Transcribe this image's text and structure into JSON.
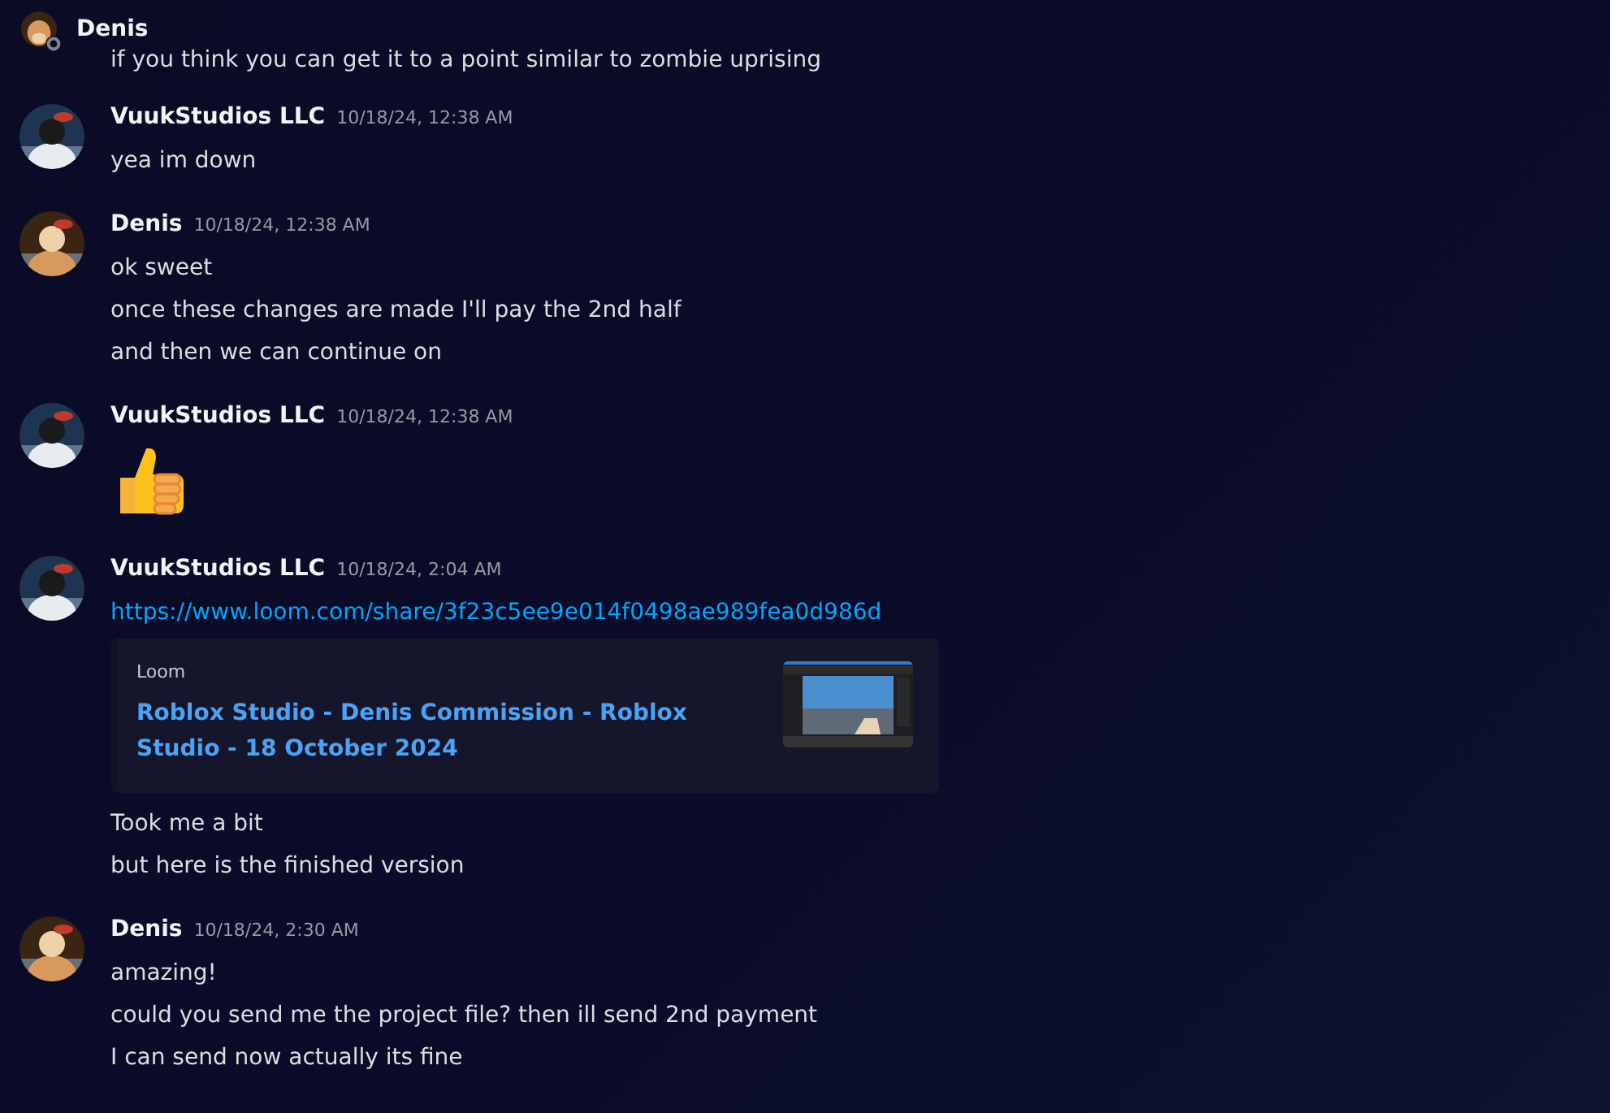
{
  "header": {
    "name": "Denis"
  },
  "cut_line": "if you think you can get it to a point similar to zombie uprising",
  "messages": [
    {
      "author": "VuukStudios LLC",
      "time": "10/18/24, 12:38 AM",
      "lines": [
        {
          "kind": "text",
          "text": "yea im down"
        }
      ]
    },
    {
      "author": "Denis",
      "time": "10/18/24, 12:38 AM",
      "lines": [
        {
          "kind": "text",
          "text": "ok sweet"
        },
        {
          "kind": "text",
          "text": "once these changes are made I'll pay the 2nd half"
        },
        {
          "kind": "text",
          "text": "and then we can continue on"
        }
      ]
    },
    {
      "author": "VuukStudios LLC",
      "time": "10/18/24, 12:38 AM",
      "lines": [
        {
          "kind": "emoji"
        }
      ]
    },
    {
      "author": "VuukStudios LLC",
      "time": "10/18/24, 2:04 AM",
      "lines": [
        {
          "kind": "link",
          "text": "https://www.loom.com/share/3f23c5ee9e014f0498ae989fea0d986d"
        },
        {
          "kind": "embed",
          "provider": "Loom",
          "title": "Roblox Studio - Denis Commission - Roblox Studio - 18 October 2024"
        },
        {
          "kind": "text",
          "text": "Took me a bit"
        },
        {
          "kind": "text",
          "text": "but here is the finished version"
        }
      ]
    },
    {
      "author": "Denis",
      "time": "10/18/24, 2:30 AM",
      "lines": [
        {
          "kind": "text",
          "text": "amazing!"
        },
        {
          "kind": "text",
          "text": "could you send me the project file? then ill send 2nd payment"
        },
        {
          "kind": "text",
          "text": "I can send now actually its fine"
        }
      ]
    }
  ]
}
